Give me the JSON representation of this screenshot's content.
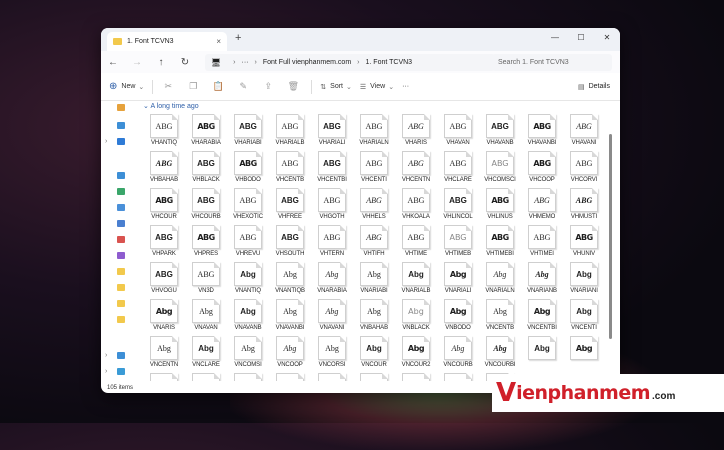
{
  "window": {
    "tab_title": "1. Font TCVN3",
    "tab_close": "×",
    "new_tab": "+",
    "controls": {
      "minimize": "—",
      "maximize": "☐",
      "close": "✕"
    }
  },
  "address": {
    "back": "←",
    "forward": "→",
    "up": "↑",
    "refresh": "↻",
    "monitor_icon": "🖥",
    "more": "···",
    "crumbs": [
      "Font Full vienphanmem.com",
      "1. Font TCVN3"
    ],
    "separator": "›",
    "search_placeholder": "Search 1. Font TCVN3"
  },
  "toolbar": {
    "new_label": "New",
    "sort_label": "Sort",
    "view_label": "View",
    "more": "···",
    "details_label": "Details"
  },
  "group_header": "A long time ago",
  "preview_sample": "ABG",
  "preview_sample_alt": "Abg",
  "fonts": [
    "VHANTIQ",
    "VHARABIA",
    "VHARIABI",
    "VHARIALB",
    "VHARIALI",
    "VHARIALN",
    "VHARIS",
    "VHAVAN",
    "VHAVANB",
    "VHAVANBI",
    "VHAVANI",
    "VHBAHAB",
    "VHBLACK",
    "VHBODO",
    "VHCENTB",
    "VHCENTBI",
    "VHCENTI",
    "VHCENTN",
    "VHCLARE",
    "VHCOMSCI",
    "VHCOOP",
    "VHCORVI",
    "VHCOUR",
    "VHCOURB",
    "VHEXOTIC",
    "VHFREE",
    "VHGOTH",
    "VHHELS",
    "VHKOALA",
    "VHLINCOL",
    "VHLINUS",
    "VHMEMO",
    "VHMUSTI",
    "VHPARK",
    "VHPRES",
    "VHREVU",
    "VHSOUTH",
    "VHTERN",
    "VHTIFH",
    "VHTIME",
    "VHTIMEB",
    "VHTIMEBI",
    "VHTIMEI",
    "VHUNIV",
    "VHVOGU",
    "VN3D",
    "VNANTIQ",
    "VNANTIQB",
    "VNARABIA",
    "VNARIABI",
    "VNARIALB",
    "VNARIALI",
    "VNARIALN",
    "VNARIANB",
    "VNARIANI",
    "VNARIS",
    "VNAVAN",
    "VNAVANB",
    "VNAVANBI",
    "VNAVANI",
    "VNBAHAB",
    "VNBLACK",
    "VNBODO",
    "VNCENTB",
    "VNCENTBI",
    "VNCENTI",
    "VNCENTN",
    "VNCLARE",
    "VNCOMSI",
    "VNCOOP",
    "VNCORSI",
    "VNCOUR",
    "VNCOUR2",
    "VNCOURB",
    "VNCOURBI",
    "",
    "",
    "",
    "",
    "",
    "",
    "",
    "",
    "",
    "",
    ""
  ],
  "status": "105 items",
  "watermark": {
    "v": "V",
    "text": "ienphanmem",
    "com": ".com"
  },
  "colors": {
    "accent": "#2e5fa8",
    "watermark_red": "#d0202a",
    "folder": "#f2c94c"
  }
}
